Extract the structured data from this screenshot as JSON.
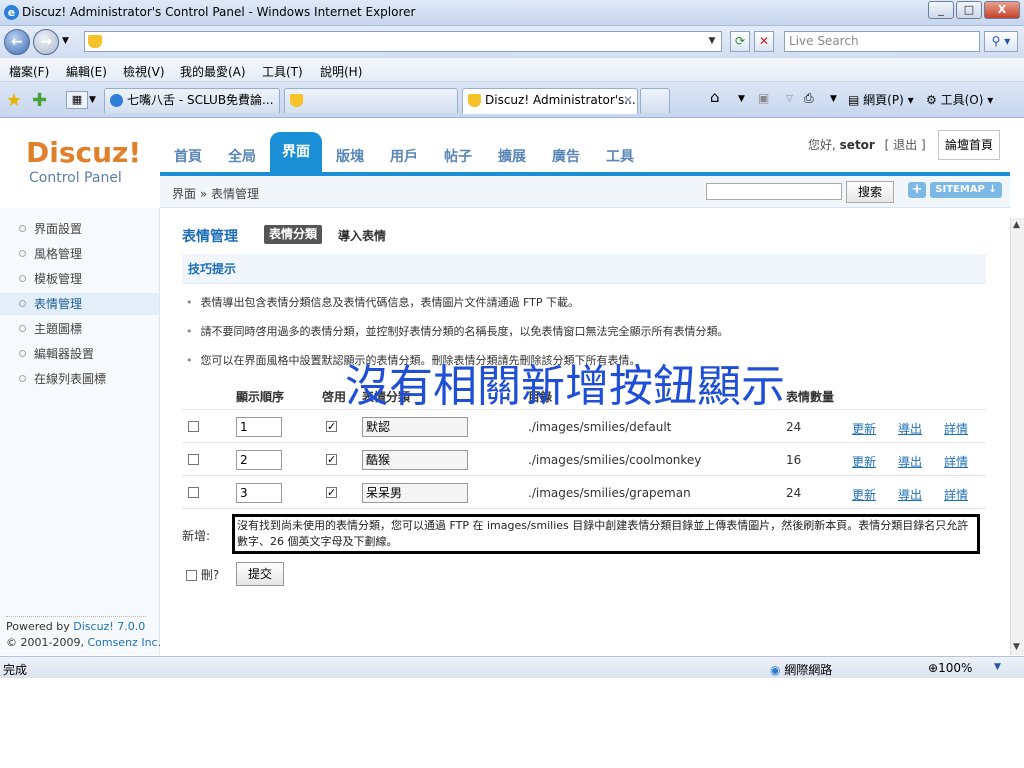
{
  "window": {
    "title": "Discuz! Administrator's Control Panel - Windows Internet Explorer",
    "controls": [
      "_",
      "□",
      "X"
    ]
  },
  "addressbar": {
    "url": "",
    "search_placeholder": "Live Search"
  },
  "menubar": [
    "檔案(F)",
    "編輯(E)",
    "檢視(V)",
    "我的最愛(A)",
    "工具(T)",
    "說明(H)"
  ],
  "tabs": [
    {
      "label": "七嘴八舌 - SCLUB免費論..."
    },
    {
      "label": ""
    },
    {
      "label": "Discuz! Administrator's..."
    }
  ],
  "commandbar": {
    "page": "網頁(P)",
    "tools": "工具(O)"
  },
  "header": {
    "logo": "Discuz!",
    "logo_sub": "Control Panel",
    "nav": [
      "首頁",
      "全局",
      "界面",
      "版塊",
      "用戶",
      "帖子",
      "擴展",
      "廣告",
      "工具"
    ],
    "active_nav": "界面",
    "greeting_prefix": "您好,",
    "username": "setor",
    "logout": "[ 退出 ]",
    "home_button": "論壇首頁"
  },
  "crumbbar": {
    "breadcrumb": "界面 » 表情管理",
    "search_button": "搜索",
    "plus": "+",
    "sitemap": "SITEMAP ↓"
  },
  "sidebar": {
    "items": [
      "界面設置",
      "風格管理",
      "模板管理",
      "表情管理",
      "主題圖標",
      "編輯器設置",
      "在線列表圖標"
    ],
    "active": "表情管理",
    "powered_prefix": "Powered by ",
    "powered_link": "Discuz! 7.0.0",
    "copyright_prefix": "© 2001-2009, ",
    "copyright_link": "Comsenz Inc."
  },
  "content": {
    "title": "表情管理",
    "tab_active": "表情分類",
    "tab_other": "導入表情",
    "tips_title": "技巧提示",
    "tips": [
      "表情導出包含表情分類信息及表情代碼信息，表情圖片文件請通過 FTP 下載。",
      "請不要同時啓用過多的表情分類，並控制好表情分類的名稱長度，以免表情窗口無法完全顯示所有表情分類。",
      "您可以在界面風格中設置默認顯示的表情分類。刪除表情分類請先刪除該分類下所有表情。"
    ],
    "columns": {
      "order": "顯示順序",
      "enabled": "啓用",
      "name": "表情分類",
      "dir": "目錄",
      "count": "表情數量"
    },
    "rows": [
      {
        "order": "1",
        "name": "默認",
        "dir": "./images/smilies/default",
        "count": "24"
      },
      {
        "order": "2",
        "name": "酷猴",
        "dir": "./images/smilies/coolmonkey",
        "count": "16"
      },
      {
        "order": "3",
        "name": "呆呆男",
        "dir": "./images/smilies/grapeman",
        "count": "24"
      }
    ],
    "row_actions": [
      "更新",
      "導出",
      "詳情"
    ],
    "add_label": "新增:",
    "add_notice": "沒有找到尚未使用的表情分類，您可以通過 FTP 在 images/smilies 目錄中創建表情分類目錄並上傳表情圖片，然後刷新本頁。表情分類目錄名只允許數字、26 個英文字母及下劃線。",
    "delete_label": "刪?",
    "submit": "提交"
  },
  "annotation": "沒有相關新增按鈕顯示",
  "statusbar": {
    "status": "完成",
    "zone": "網際網路",
    "zoom": "100%"
  }
}
